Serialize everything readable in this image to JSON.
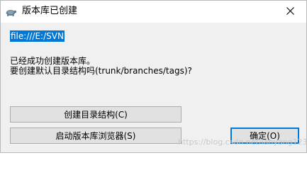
{
  "window": {
    "title": "版本库已创建",
    "app_icon": "tortoise-icon",
    "close_icon": "close-icon"
  },
  "content": {
    "repository_path": "file:///E:/SVN",
    "message_line_1": "已经成功创建版本库。",
    "message_line_2": "要创建默认目录结构吗(trunk/branches/tags)?"
  },
  "buttons": {
    "create_structure_label": "创建目录结构(C)",
    "launch_browser_label": "启动版本库浏览器(S)",
    "ok_label": "确定(O)"
  },
  "watermark": "https://blog.csdn.net/lanyang123",
  "colors": {
    "selection": "#0078d7",
    "focus_border": "#0078d7",
    "button_face": "#e1e1e1",
    "dialog_background": "#f0f0f0"
  }
}
